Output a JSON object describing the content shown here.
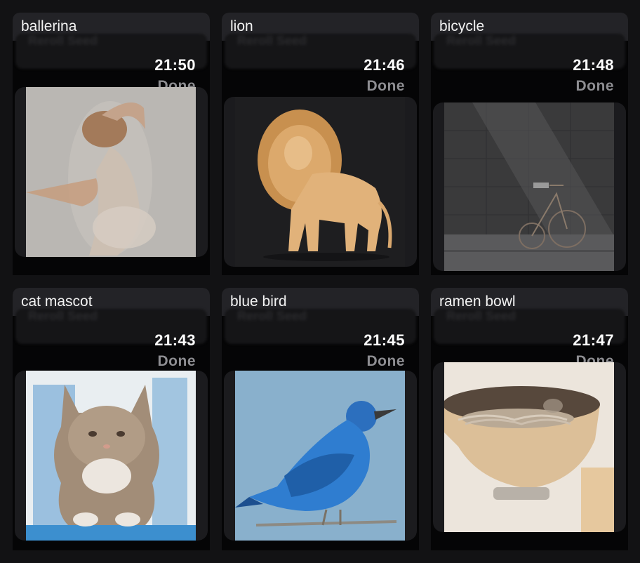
{
  "cards": [
    {
      "title": "ballerina",
      "ghost_label": "Reroll Seed",
      "time": "21:50",
      "status": "Done",
      "image_label": "ballerina-image"
    },
    {
      "title": "lion",
      "ghost_label": "Reroll Seed",
      "time": "21:46",
      "status": "Done",
      "image_label": "lion-image"
    },
    {
      "title": "bicycle",
      "ghost_label": "Reroll Seed",
      "time": "21:48",
      "status": "Done",
      "image_label": "bicycle-image"
    },
    {
      "title": "cat mascot",
      "ghost_label": "Reroll Seed",
      "time": "21:43",
      "status": "Done",
      "image_label": "cat-mascot-image"
    },
    {
      "title": "blue bird",
      "ghost_label": "Reroll Seed",
      "time": "21:45",
      "status": "Done",
      "image_label": "blue-bird-image"
    },
    {
      "title": "ramen bowl",
      "ghost_label": "Reroll Seed",
      "time": "21:47",
      "status": "Done",
      "image_label": "ramen-bowl-image"
    }
  ],
  "colors": {
    "background": "#121214",
    "header": "#232327",
    "card_body": "#050506",
    "time_text": "#ffffff",
    "status_text": "#8e8e92"
  }
}
